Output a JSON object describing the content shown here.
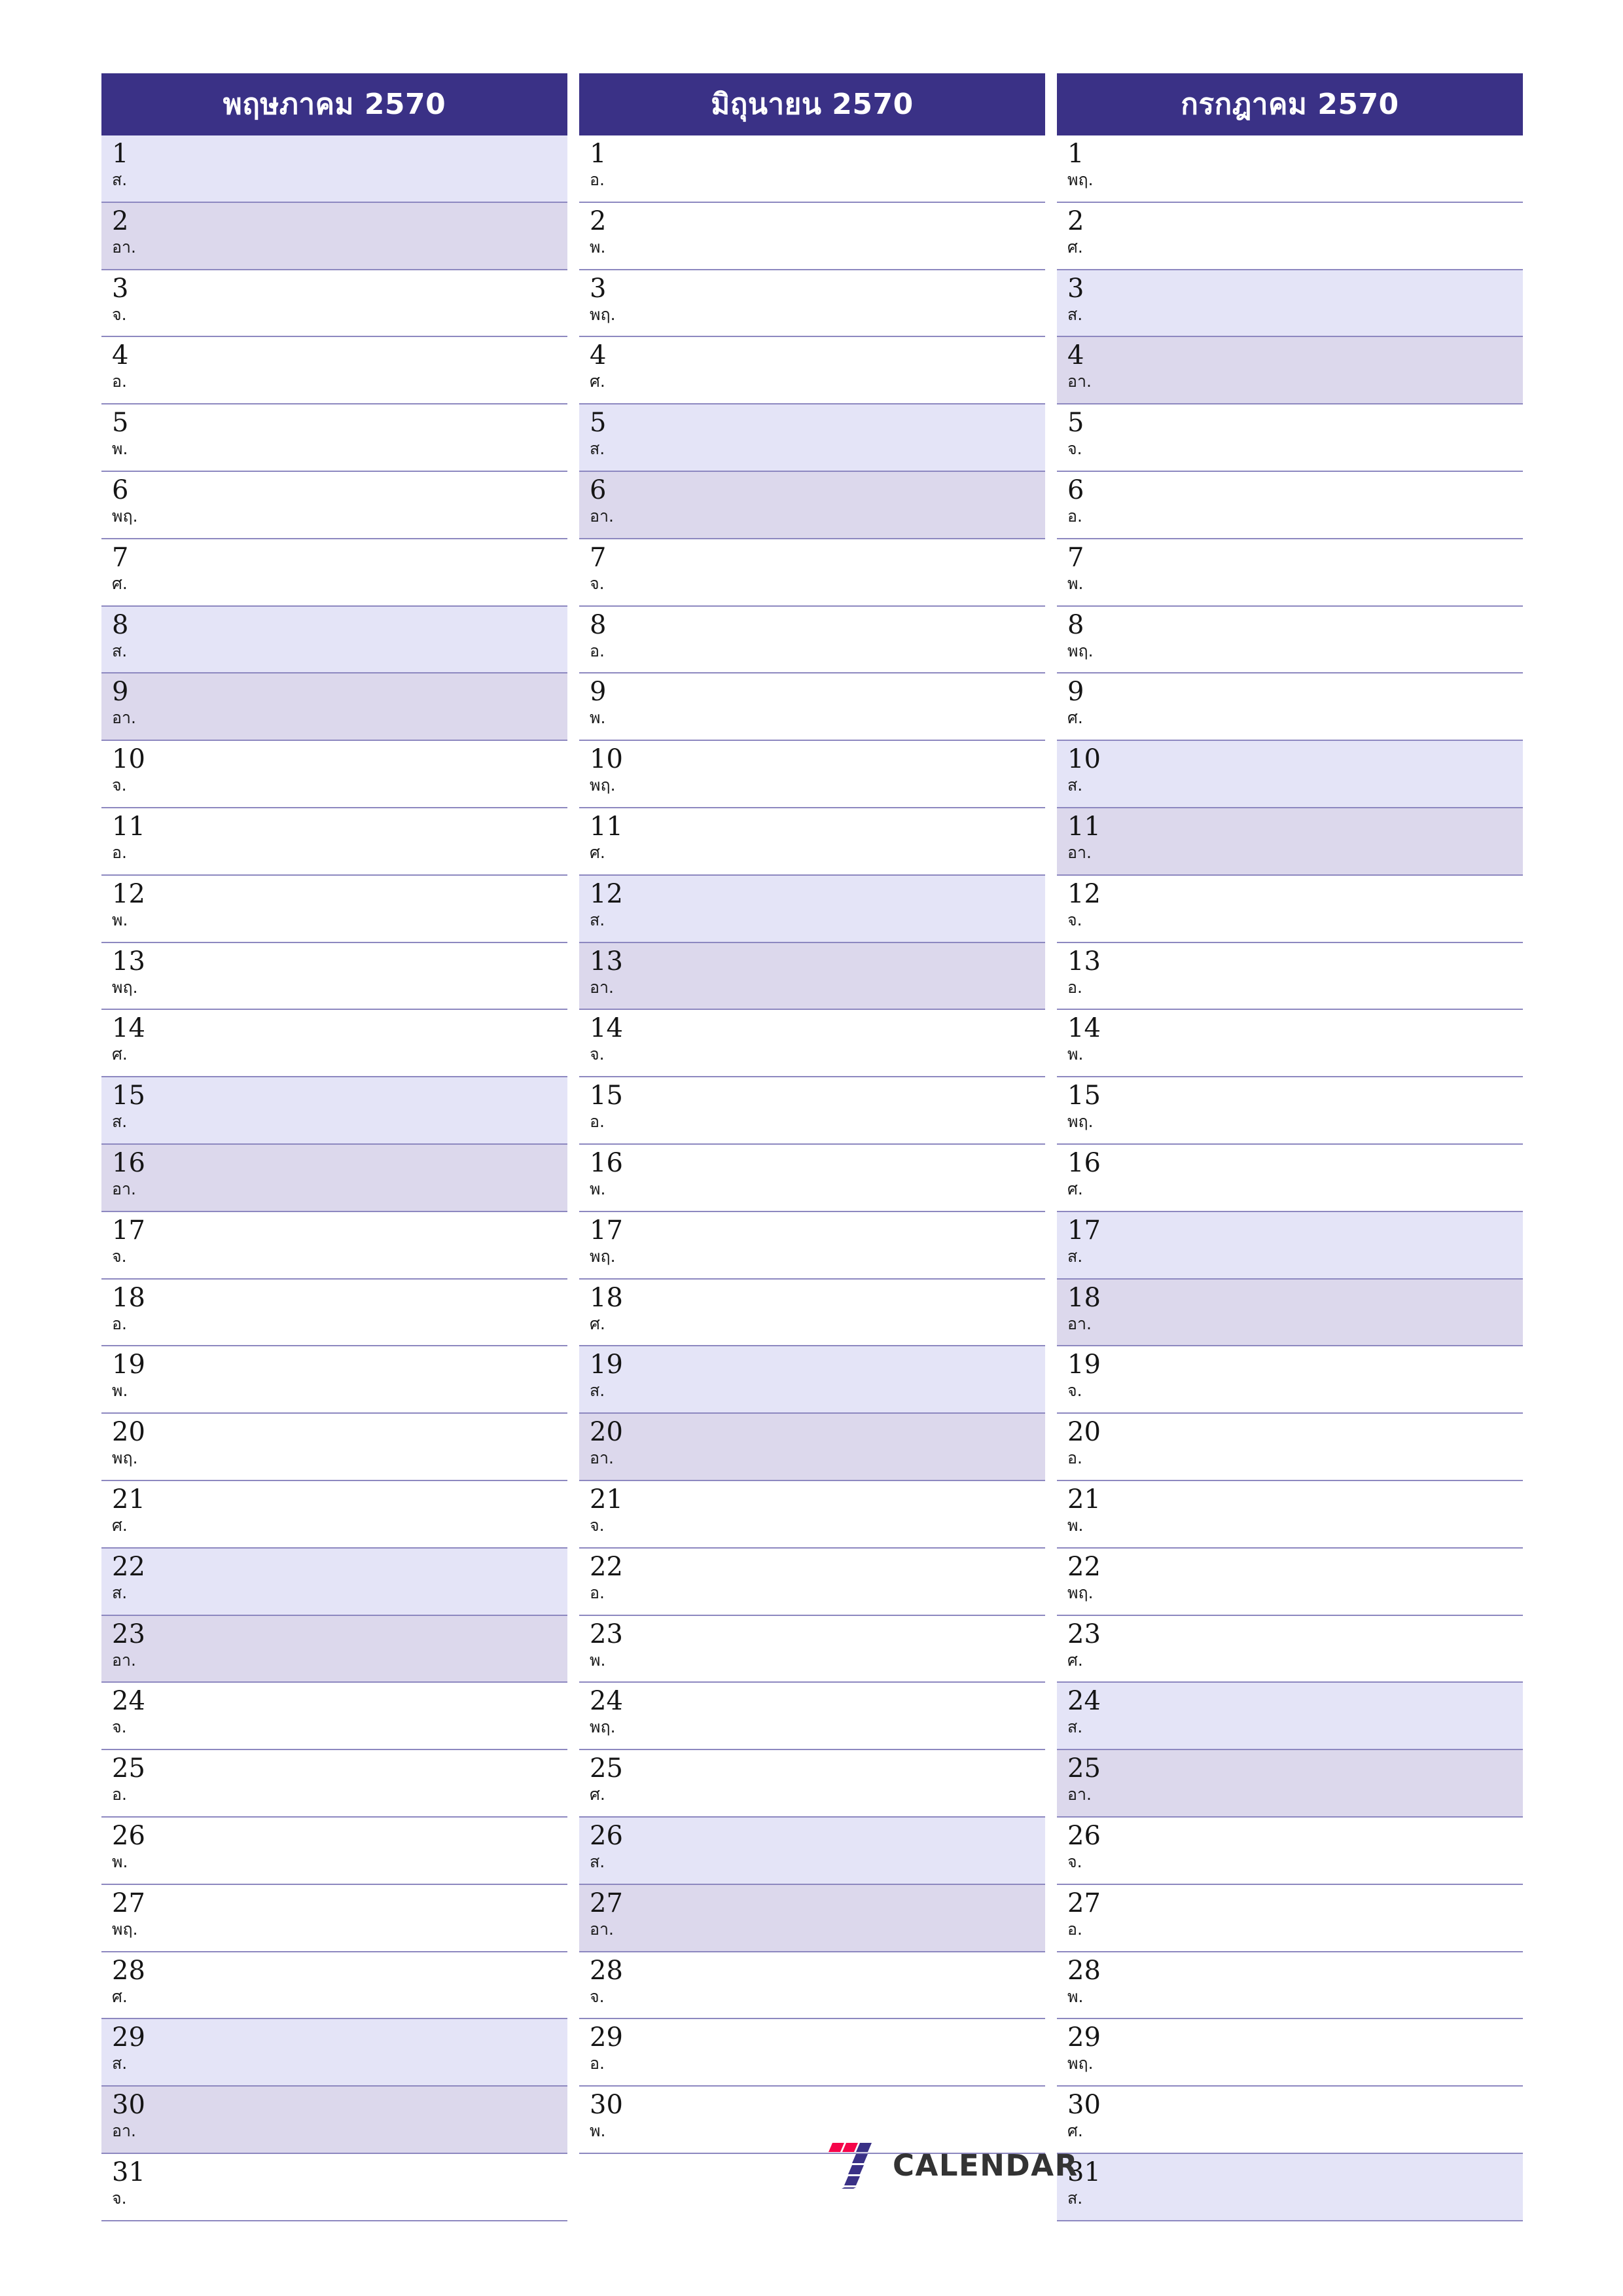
{
  "page": {
    "type": "three-month-planner",
    "colors": {
      "header_bg": "#3a3186",
      "header_text": "#ffffff",
      "saturday_bg": "#e4e4f7",
      "sunday_bg": "#dcd8ec",
      "row_border": "#8d88c0",
      "day_text": "#151515",
      "logo_red": "#f5054a",
      "logo_navy": "#3a3186",
      "logo_text": "#333333"
    }
  },
  "weekday_abbr": {
    "mon": "จ.",
    "tue": "อ.",
    "wed": "พ.",
    "thu": "พฤ.",
    "fri": "ศ.",
    "sat": "ส.",
    "sun": "อา."
  },
  "months": [
    {
      "title": "พฤษภาคม 2570",
      "days": [
        {
          "num": "1",
          "wd": "ส.",
          "type": "sat"
        },
        {
          "num": "2",
          "wd": "อา.",
          "type": "sun"
        },
        {
          "num": "3",
          "wd": "จ.",
          "type": ""
        },
        {
          "num": "4",
          "wd": "อ.",
          "type": ""
        },
        {
          "num": "5",
          "wd": "พ.",
          "type": ""
        },
        {
          "num": "6",
          "wd": "พฤ.",
          "type": ""
        },
        {
          "num": "7",
          "wd": "ศ.",
          "type": ""
        },
        {
          "num": "8",
          "wd": "ส.",
          "type": "sat"
        },
        {
          "num": "9",
          "wd": "อา.",
          "type": "sun"
        },
        {
          "num": "10",
          "wd": "จ.",
          "type": ""
        },
        {
          "num": "11",
          "wd": "อ.",
          "type": ""
        },
        {
          "num": "12",
          "wd": "พ.",
          "type": ""
        },
        {
          "num": "13",
          "wd": "พฤ.",
          "type": ""
        },
        {
          "num": "14",
          "wd": "ศ.",
          "type": ""
        },
        {
          "num": "15",
          "wd": "ส.",
          "type": "sat"
        },
        {
          "num": "16",
          "wd": "อา.",
          "type": "sun"
        },
        {
          "num": "17",
          "wd": "จ.",
          "type": ""
        },
        {
          "num": "18",
          "wd": "อ.",
          "type": ""
        },
        {
          "num": "19",
          "wd": "พ.",
          "type": ""
        },
        {
          "num": "20",
          "wd": "พฤ.",
          "type": ""
        },
        {
          "num": "21",
          "wd": "ศ.",
          "type": ""
        },
        {
          "num": "22",
          "wd": "ส.",
          "type": "sat"
        },
        {
          "num": "23",
          "wd": "อา.",
          "type": "sun"
        },
        {
          "num": "24",
          "wd": "จ.",
          "type": ""
        },
        {
          "num": "25",
          "wd": "อ.",
          "type": ""
        },
        {
          "num": "26",
          "wd": "พ.",
          "type": ""
        },
        {
          "num": "27",
          "wd": "พฤ.",
          "type": ""
        },
        {
          "num": "28",
          "wd": "ศ.",
          "type": ""
        },
        {
          "num": "29",
          "wd": "ส.",
          "type": "sat"
        },
        {
          "num": "30",
          "wd": "อา.",
          "type": "sun"
        },
        {
          "num": "31",
          "wd": "จ.",
          "type": ""
        }
      ]
    },
    {
      "title": "มิถุนายน 2570",
      "days": [
        {
          "num": "1",
          "wd": "อ.",
          "type": ""
        },
        {
          "num": "2",
          "wd": "พ.",
          "type": ""
        },
        {
          "num": "3",
          "wd": "พฤ.",
          "type": ""
        },
        {
          "num": "4",
          "wd": "ศ.",
          "type": ""
        },
        {
          "num": "5",
          "wd": "ส.",
          "type": "sat"
        },
        {
          "num": "6",
          "wd": "อา.",
          "type": "sun"
        },
        {
          "num": "7",
          "wd": "จ.",
          "type": ""
        },
        {
          "num": "8",
          "wd": "อ.",
          "type": ""
        },
        {
          "num": "9",
          "wd": "พ.",
          "type": ""
        },
        {
          "num": "10",
          "wd": "พฤ.",
          "type": ""
        },
        {
          "num": "11",
          "wd": "ศ.",
          "type": ""
        },
        {
          "num": "12",
          "wd": "ส.",
          "type": "sat"
        },
        {
          "num": "13",
          "wd": "อา.",
          "type": "sun"
        },
        {
          "num": "14",
          "wd": "จ.",
          "type": ""
        },
        {
          "num": "15",
          "wd": "อ.",
          "type": ""
        },
        {
          "num": "16",
          "wd": "พ.",
          "type": ""
        },
        {
          "num": "17",
          "wd": "พฤ.",
          "type": ""
        },
        {
          "num": "18",
          "wd": "ศ.",
          "type": ""
        },
        {
          "num": "19",
          "wd": "ส.",
          "type": "sat"
        },
        {
          "num": "20",
          "wd": "อา.",
          "type": "sun"
        },
        {
          "num": "21",
          "wd": "จ.",
          "type": ""
        },
        {
          "num": "22",
          "wd": "อ.",
          "type": ""
        },
        {
          "num": "23",
          "wd": "พ.",
          "type": ""
        },
        {
          "num": "24",
          "wd": "พฤ.",
          "type": ""
        },
        {
          "num": "25",
          "wd": "ศ.",
          "type": ""
        },
        {
          "num": "26",
          "wd": "ส.",
          "type": "sat"
        },
        {
          "num": "27",
          "wd": "อา.",
          "type": "sun"
        },
        {
          "num": "28",
          "wd": "จ.",
          "type": ""
        },
        {
          "num": "29",
          "wd": "อ.",
          "type": ""
        },
        {
          "num": "30",
          "wd": "พ.",
          "type": ""
        }
      ]
    },
    {
      "title": "กรกฎาคม 2570",
      "days": [
        {
          "num": "1",
          "wd": "พฤ.",
          "type": ""
        },
        {
          "num": "2",
          "wd": "ศ.",
          "type": ""
        },
        {
          "num": "3",
          "wd": "ส.",
          "type": "sat"
        },
        {
          "num": "4",
          "wd": "อา.",
          "type": "sun"
        },
        {
          "num": "5",
          "wd": "จ.",
          "type": ""
        },
        {
          "num": "6",
          "wd": "อ.",
          "type": ""
        },
        {
          "num": "7",
          "wd": "พ.",
          "type": ""
        },
        {
          "num": "8",
          "wd": "พฤ.",
          "type": ""
        },
        {
          "num": "9",
          "wd": "ศ.",
          "type": ""
        },
        {
          "num": "10",
          "wd": "ส.",
          "type": "sat"
        },
        {
          "num": "11",
          "wd": "อา.",
          "type": "sun"
        },
        {
          "num": "12",
          "wd": "จ.",
          "type": ""
        },
        {
          "num": "13",
          "wd": "อ.",
          "type": ""
        },
        {
          "num": "14",
          "wd": "พ.",
          "type": ""
        },
        {
          "num": "15",
          "wd": "พฤ.",
          "type": ""
        },
        {
          "num": "16",
          "wd": "ศ.",
          "type": ""
        },
        {
          "num": "17",
          "wd": "ส.",
          "type": "sat"
        },
        {
          "num": "18",
          "wd": "อา.",
          "type": "sun"
        },
        {
          "num": "19",
          "wd": "จ.",
          "type": ""
        },
        {
          "num": "20",
          "wd": "อ.",
          "type": ""
        },
        {
          "num": "21",
          "wd": "พ.",
          "type": ""
        },
        {
          "num": "22",
          "wd": "พฤ.",
          "type": ""
        },
        {
          "num": "23",
          "wd": "ศ.",
          "type": ""
        },
        {
          "num": "24",
          "wd": "ส.",
          "type": "sat"
        },
        {
          "num": "25",
          "wd": "อา.",
          "type": "sun"
        },
        {
          "num": "26",
          "wd": "จ.",
          "type": ""
        },
        {
          "num": "27",
          "wd": "อ.",
          "type": ""
        },
        {
          "num": "28",
          "wd": "พ.",
          "type": ""
        },
        {
          "num": "29",
          "wd": "พฤ.",
          "type": ""
        },
        {
          "num": "30",
          "wd": "ศ.",
          "type": ""
        },
        {
          "num": "31",
          "wd": "ส.",
          "type": "sat"
        }
      ]
    }
  ],
  "brand": {
    "name": "CALENDAR",
    "mark": "seven-logo-icon"
  }
}
